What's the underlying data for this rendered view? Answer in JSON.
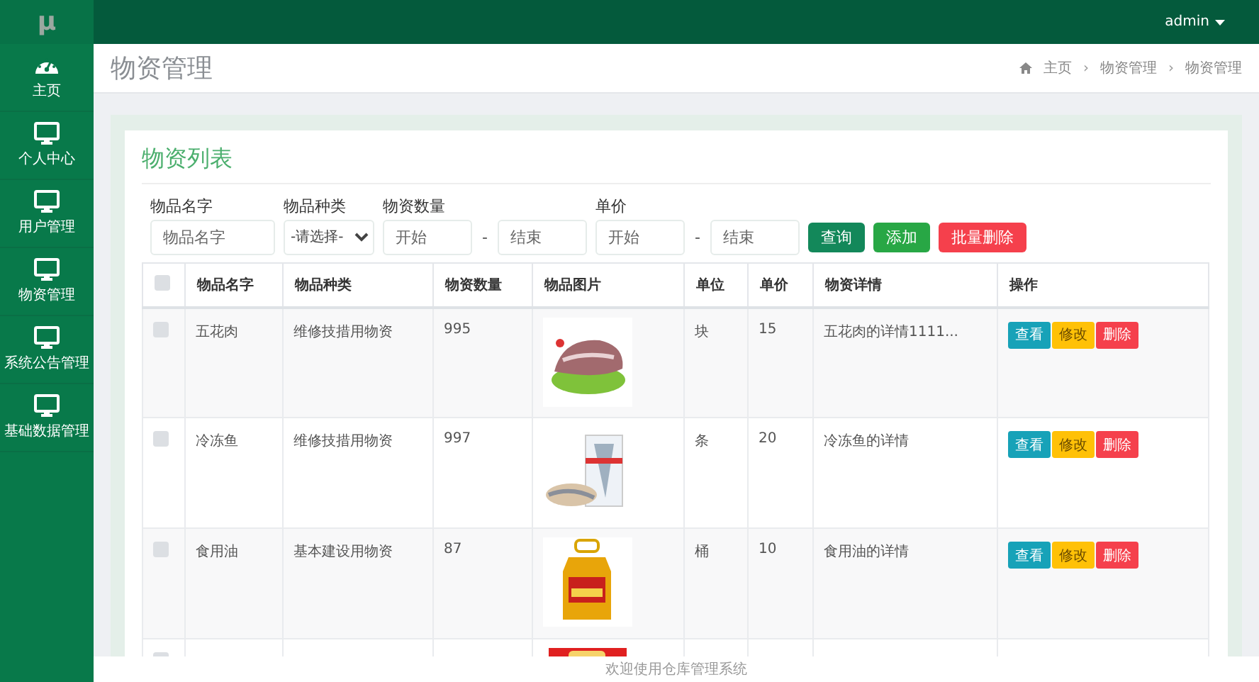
{
  "logo": "μ",
  "sidebar": {
    "items": [
      {
        "label": "主页"
      },
      {
        "label": "个人中心"
      },
      {
        "label": "用户管理"
      },
      {
        "label": "物资管理"
      },
      {
        "label": "系统公告管理"
      },
      {
        "label": "基础数据管理"
      }
    ]
  },
  "user_menu": {
    "label": "admin"
  },
  "page_title": "物资管理",
  "breadcrumb": {
    "separator": "›",
    "items": [
      "主页",
      "物资管理",
      "物资管理"
    ]
  },
  "card_title": "物资列表",
  "filters": {
    "name": {
      "label": "物品名字",
      "placeholder": "物品名字"
    },
    "type": {
      "label": "物品种类",
      "value": "-请选择-"
    },
    "quantity": {
      "label": "物资数量",
      "from_placeholder": "开始",
      "separator": "-",
      "to_placeholder": "结束"
    },
    "price": {
      "label": "单价",
      "from_placeholder": "开始",
      "separator": "-",
      "to_placeholder": "结束"
    }
  },
  "actions": [
    {
      "label": "查询",
      "kind": "search"
    },
    {
      "label": "添加",
      "kind": "add"
    },
    {
      "label": "批量删除",
      "kind": "delete"
    }
  ],
  "table": {
    "select_all": {
      "checked": false
    },
    "columns": [
      "物品名字",
      "物品种类",
      "物资数量",
      "物品图片",
      "单位",
      "单价",
      "物资详情",
      "操作"
    ],
    "rows": [
      {
        "checked": false,
        "name": "五花肉",
        "type": "维修技措用物资",
        "quantity": "995",
        "unit": "块",
        "price": "15",
        "details": "五花肉的详情1111...",
        "buttons": [
          "查看",
          "修改",
          "删除"
        ]
      },
      {
        "checked": false,
        "name": "冷冻鱼",
        "type": "维修技措用物资",
        "quantity": "997",
        "unit": "条",
        "price": "20",
        "details": "冷冻鱼的详情",
        "buttons": [
          "查看",
          "修改",
          "删除"
        ]
      },
      {
        "checked": false,
        "name": "食用油",
        "type": "基本建设用物资",
        "quantity": "87",
        "unit": "桶",
        "price": "10",
        "details": "食用油的详情",
        "buttons": [
          "查看",
          "修改",
          "删除"
        ]
      },
      {
        "checked": false
      }
    ]
  },
  "footer": "欢迎使用仓库管理系统"
}
